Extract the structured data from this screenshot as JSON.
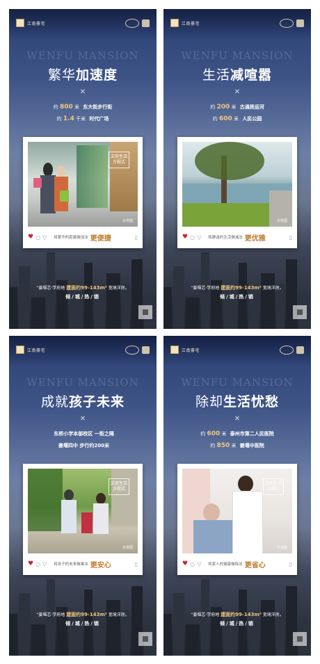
{
  "brand": {
    "logo_text": "江南豪宅",
    "watermark": "WENFU MANSION"
  },
  "posters": [
    {
      "headline_light": "繁华",
      "headline_bold": "加速度",
      "cross": "✕",
      "lines": [
        {
          "pre": "约",
          "value": "800",
          "unit": "米",
          "place": "东大街步行街"
        },
        {
          "pre": "约",
          "value": "1.4",
          "unit": "千米",
          "place": "时代广场"
        }
      ],
      "card_tag": "文府生活方程式",
      "card_caption": "将繁华的距离做加法",
      "card_emphasis": "更便捷",
      "photo_tag": "示意图"
    },
    {
      "headline_light": "生活",
      "headline_bold": "减喧嚣",
      "cross": "✕",
      "lines": [
        {
          "pre": "约",
          "value": "200",
          "unit": "米",
          "place": "古通扬运河"
        },
        {
          "pre": "约",
          "value": "600",
          "unit": "米",
          "place": "人民公园"
        }
      ],
      "card_tag": "",
      "card_caption": "将静谧的生活做减法",
      "card_emphasis": "更优雅",
      "photo_tag": "示意图"
    },
    {
      "headline_light": "成就",
      "headline_bold": "孩子未来",
      "cross": "✕",
      "lines": [
        {
          "pre": "",
          "value": "",
          "unit": "",
          "place": "东桥小学本部校区 一街之隔"
        },
        {
          "pre": "",
          "value": "",
          "unit": "",
          "place": "姜堰四中 步行约200米"
        }
      ],
      "card_tag": "文府生活方程式",
      "card_caption": "将孩子的未来做乘法",
      "card_emphasis": "更安心",
      "photo_tag": "示意图"
    },
    {
      "headline_light": "除却",
      "headline_bold": "生活忧愁",
      "cross": "✕",
      "lines": [
        {
          "pre": "约",
          "value": "600",
          "unit": "米",
          "place": "泰州市第二人民医院"
        },
        {
          "pre": "约",
          "value": "850",
          "unit": "米",
          "place": "姜堰中医院"
        }
      ],
      "card_tag": "文府生活方程式",
      "card_caption": "将家人的健康做除法",
      "card_emphasis": "更省心",
      "photo_tag": "示意图"
    }
  ],
  "footer": {
    "project": "“姜堰芯·学府地",
    "range": "建面约99-143m²",
    "suffix": "宽境洋房。",
    "sale": "倾/城/热/销"
  }
}
